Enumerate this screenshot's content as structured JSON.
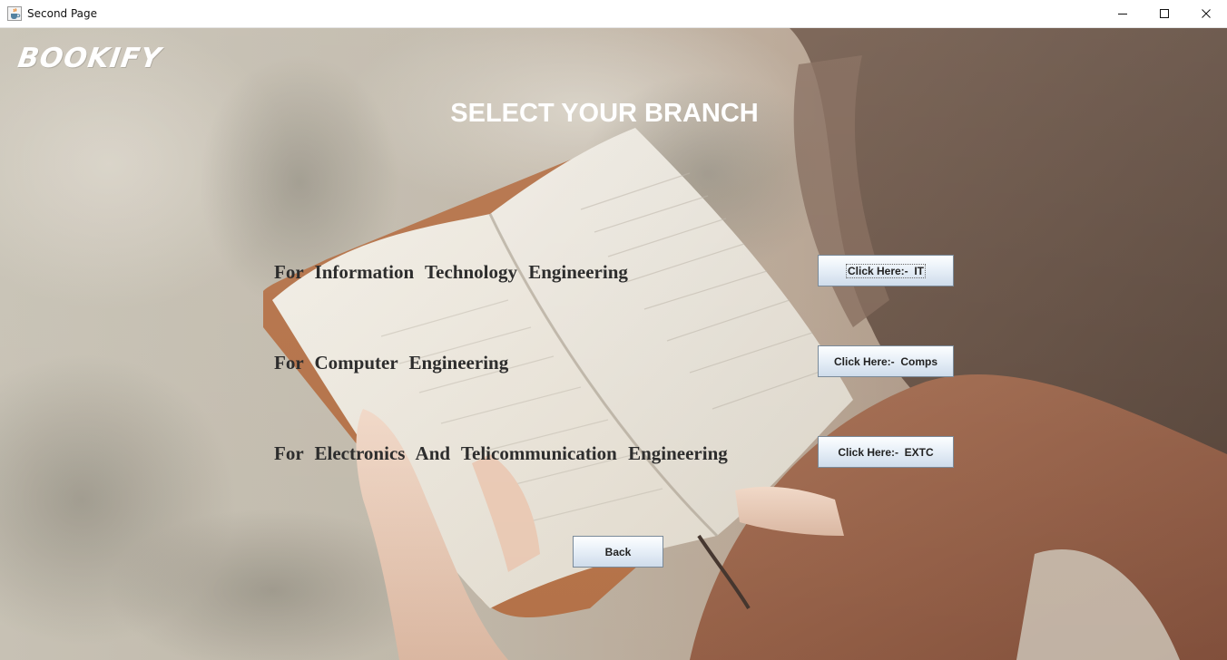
{
  "window": {
    "title": "Second Page",
    "icons": [
      "java-cup-icon",
      "minimize-icon",
      "maximize-icon",
      "close-icon"
    ]
  },
  "logo": "BOOKIFY",
  "heading": "SELECT YOUR BRANCH",
  "branches": [
    {
      "label": "For  Information  Technology  Engineering",
      "button": "Click Here:-  IT"
    },
    {
      "label": "For  Computer  Engineering",
      "button": "Click Here:-  Comps"
    },
    {
      "label": "For  Electronics And Telicommunication Engineering",
      "button": "Click Here:-  EXTC"
    }
  ],
  "back_button": "Back",
  "colors": {
    "label_text": "#2d2d2d",
    "heading_text": "#ffffff",
    "button_border": "#7a8a99"
  }
}
